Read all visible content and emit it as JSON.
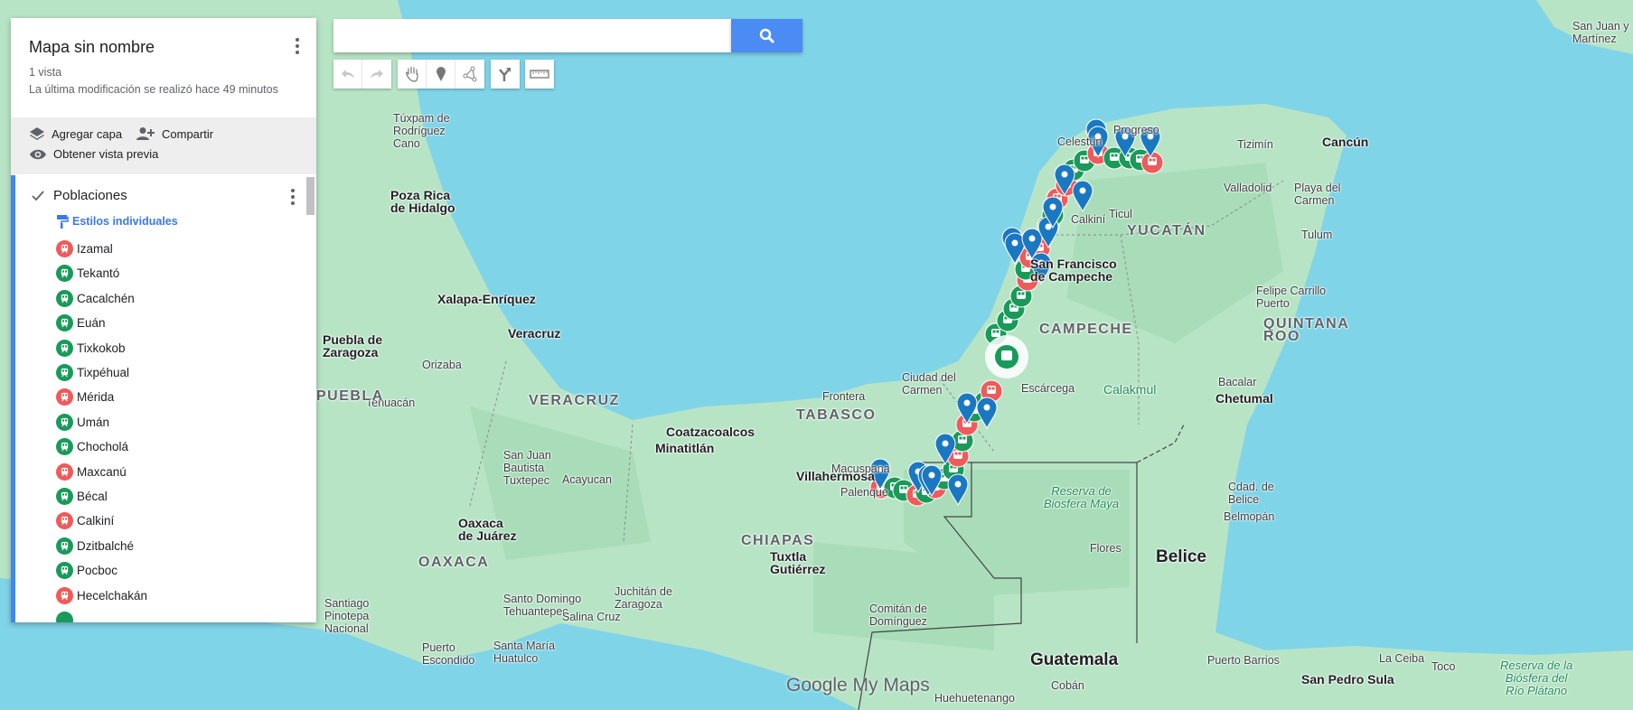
{
  "panel": {
    "title": "Mapa sin nombre",
    "views": "1 vista",
    "last_modified": "La última modificación se realizó hace 49 minutos",
    "actions": {
      "add_layer": "Agregar capa",
      "share": "Compartir",
      "preview": "Obtener vista previa"
    },
    "layer": {
      "name": "Poblaciones",
      "checked": true,
      "style_label": "Estilos individuales",
      "items": [
        {
          "label": "Izamal",
          "color": "red"
        },
        {
          "label": "Tekantó",
          "color": "green"
        },
        {
          "label": "Cacalchén",
          "color": "green"
        },
        {
          "label": "Euán",
          "color": "green"
        },
        {
          "label": "Tixkokob",
          "color": "green"
        },
        {
          "label": "Tixpéhual",
          "color": "green"
        },
        {
          "label": "Mérida",
          "color": "red"
        },
        {
          "label": "Umán",
          "color": "green"
        },
        {
          "label": "Chocholá",
          "color": "green"
        },
        {
          "label": "Maxcanú",
          "color": "red"
        },
        {
          "label": "Bécal",
          "color": "green"
        },
        {
          "label": "Calkiní",
          "color": "red"
        },
        {
          "label": "Dzitbalché",
          "color": "green"
        },
        {
          "label": "Pocboc",
          "color": "green"
        },
        {
          "label": "Hecelchakán",
          "color": "red"
        }
      ]
    }
  },
  "search": {
    "value": "",
    "placeholder": ""
  },
  "toolbar": [
    "undo-icon",
    "redo-icon",
    "hand-icon",
    "add-marker-icon",
    "draw-line-icon",
    "directions-icon",
    "ruler-icon"
  ],
  "colors": {
    "red": "#f05a5a",
    "green": "#1a9a5a",
    "blue_pin": "#1a78c2",
    "accent": "#4285f4"
  },
  "map": {
    "labels": [
      "Túxpam de\nRodríguez\nCano",
      "Poza Rica\nde Hidalgo",
      "Xalapa-Enríquez",
      "Veracruz",
      "Puebla de\nZaragoza",
      "Orizaba",
      "Tehuacán",
      "VERACRUZ",
      "TABASCO",
      "Frontera",
      "Ciudad del\nCarmen",
      "Villahermosa",
      "Coatzacoalcos",
      "Minatitlán",
      "San Juan\nBautista\nTuxtepec",
      "Acayucan",
      "Oaxaca\nde Juárez",
      "OAXACA",
      "CHIAPAS",
      "Tuxtla\nGutiérrez",
      "Santiago\nPinotepa\nNacional",
      "Santo Domingo\nTehuantepec",
      "Juchitán de\nZaragoza",
      "Salina Cruz",
      "Puerto\nEscondido",
      "Santa María\nHuatulco",
      "Comitán de\nDomínguez",
      "Huehuetenango",
      "Cobán",
      "Guatemala",
      "Puerto Barrios",
      "San Pedro Sula",
      "La Ceiba",
      "Toco",
      "Reserva de la\nBiósfera del\nRío Plátano",
      "Reserva de\nBiosfera Maya",
      "Flores",
      "Belice",
      "Belmopán",
      "Cdad. de\nBelice",
      "Chetumal",
      "Bacalar",
      "Calakmul",
      "Escárcega",
      "CAMPECHE",
      "San Francisco\nde Campeche",
      "YUCATÁN",
      "Ticul",
      "QUINTANA\nROO",
      "Felipe Carrillo\nPuerto",
      "Tulum",
      "Playa del\nCarmen",
      "Valladolid",
      "Tizimín",
      "Cancún",
      "Progreso",
      "Celestún",
      "Calkiní",
      "Macuspana",
      "Palenque",
      "San Juan y\nMartínez",
      "PUEBLA"
    ],
    "logo": "Google My Maps"
  }
}
